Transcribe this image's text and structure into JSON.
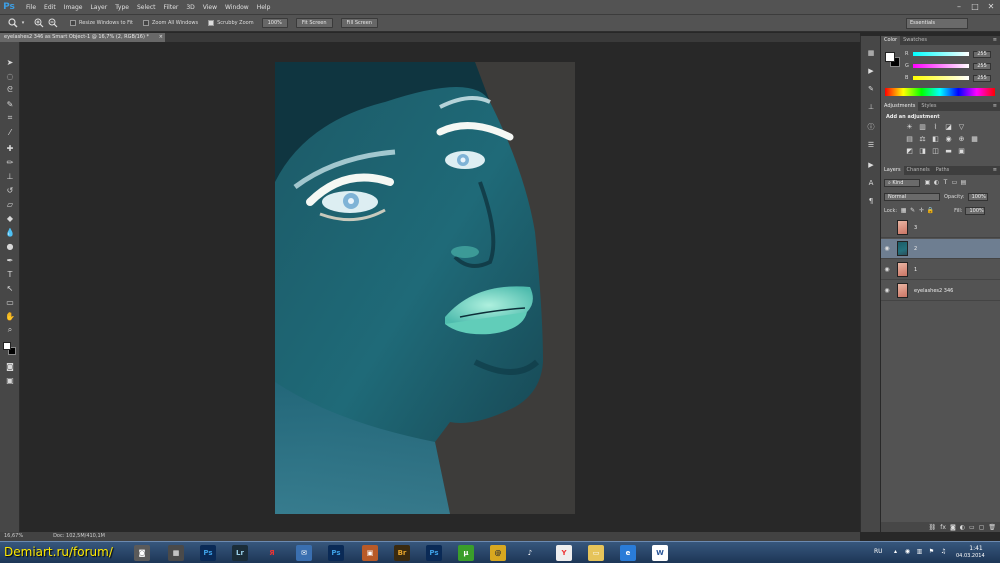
{
  "app": {
    "logo": "Ps"
  },
  "menu": [
    "File",
    "Edit",
    "Image",
    "Layer",
    "Type",
    "Select",
    "Filter",
    "3D",
    "View",
    "Window",
    "Help"
  ],
  "window_controls": [
    "–",
    "□",
    "✕"
  ],
  "options_bar": {
    "tool_icon": "zoom-icon",
    "checks": [
      "Resize Windows to Fit",
      "Zoom All Windows",
      "Scrubby Zoom"
    ],
    "buttons": [
      "100%",
      "Fit Screen",
      "Fill Screen"
    ],
    "workspace": "Essentials"
  },
  "document_tab": {
    "title": "eyelashes2 346 as Smart Object-1 @ 16,7% (2, RGB/16) *",
    "close": "×"
  },
  "status_bar": {
    "zoom": "16,67%",
    "doc": "Doc: 102,5M/410,1M"
  },
  "color_panel": {
    "tabs": [
      "Color",
      "Swatches"
    ],
    "channels": [
      {
        "label": "R",
        "value": "255"
      },
      {
        "label": "G",
        "value": "255"
      },
      {
        "label": "B",
        "value": "255"
      }
    ]
  },
  "adjustments_panel": {
    "tabs": [
      "Adjustments",
      "Styles"
    ],
    "title": "Add an adjustment"
  },
  "layers_panel": {
    "tabs": [
      "Layers",
      "Channels",
      "Paths"
    ],
    "filter": "Kind",
    "blend_mode": "Normal",
    "opacity_label": "Opacity:",
    "opacity_value": "100%",
    "lock_label": "Lock:",
    "fill_label": "Fill:",
    "fill_value": "100%",
    "layers": [
      {
        "name": "3",
        "visible": false,
        "selected": false,
        "thumb": "face"
      },
      {
        "name": "2",
        "visible": true,
        "selected": true,
        "thumb": "inverted"
      },
      {
        "name": "1",
        "visible": true,
        "selected": false,
        "thumb": "face"
      },
      {
        "name": "eyelashes2 346",
        "visible": true,
        "selected": false,
        "thumb": "face"
      }
    ]
  },
  "taskbar": {
    "watermark": "Demiart.ru/forum/",
    "apps": [
      "Ps",
      "Lr",
      "Я",
      "Ps",
      "Br",
      "Ps",
      "@",
      "W"
    ],
    "language": "RU",
    "time": "1:41",
    "date": "04.03.2014"
  }
}
